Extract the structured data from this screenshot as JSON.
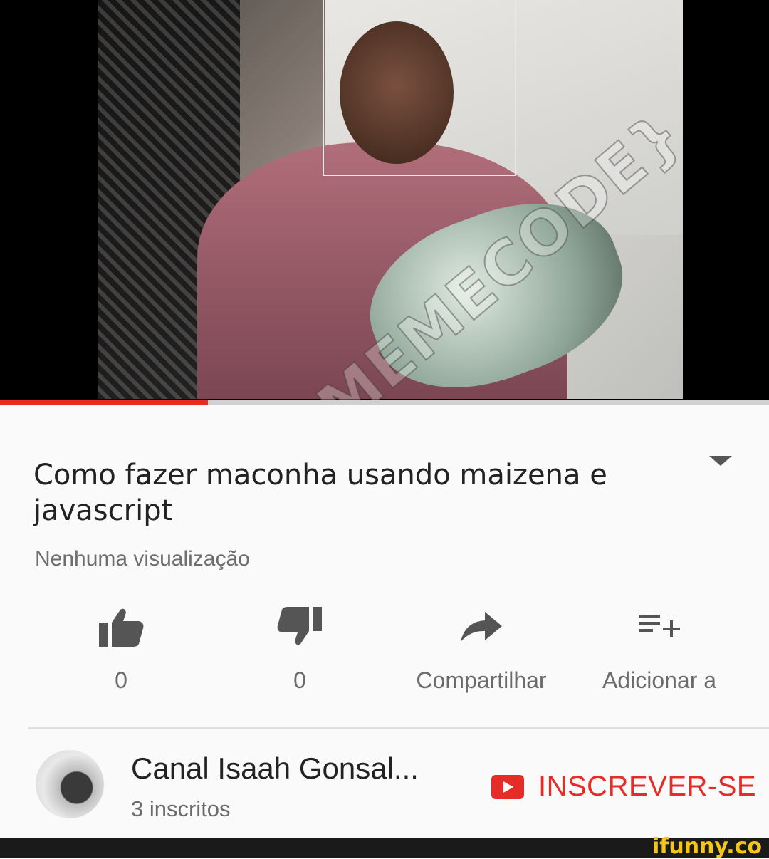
{
  "video": {
    "watermark": "{MEMECODE}",
    "progress_percent": 27
  },
  "title": "Como fazer maconha usando maizena e javascript",
  "views": "Nenhuma visualização",
  "actions": {
    "like": {
      "icon": "thumbs-up-icon",
      "label": "0"
    },
    "dislike": {
      "icon": "thumbs-down-icon",
      "label": "0"
    },
    "share": {
      "icon": "share-arrow-icon",
      "label": "Compartilhar"
    },
    "add": {
      "icon": "playlist-add-icon",
      "label": "Adicionar a"
    }
  },
  "channel": {
    "name": "Canal Isaah Gonsal...",
    "subscribers": "3 inscritos",
    "subscribe_label": "INSCREVER-SE"
  },
  "footer": {
    "brand": "ifunny.co"
  },
  "colors": {
    "accent": "#e52d27",
    "text": "#222222",
    "secondary": "#6b6b6b"
  }
}
